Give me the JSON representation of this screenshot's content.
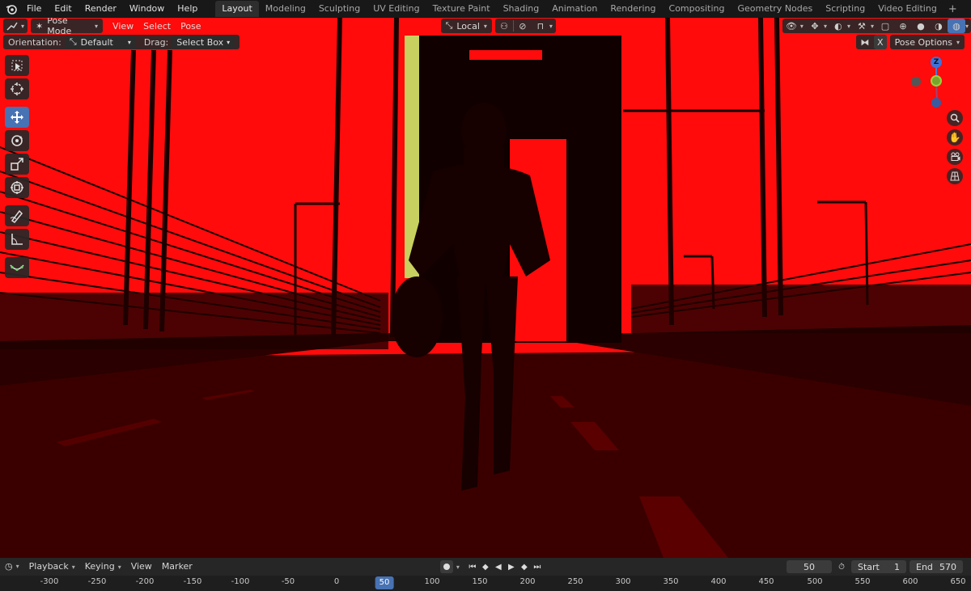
{
  "topbar": {
    "menus": [
      "File",
      "Edit",
      "Render",
      "Window",
      "Help"
    ],
    "workspaces": [
      "Layout",
      "Modeling",
      "Sculpting",
      "UV Editing",
      "Texture Paint",
      "Shading",
      "Animation",
      "Rendering",
      "Compositing",
      "Geometry Nodes",
      "Scripting",
      "Video Editing"
    ],
    "active_workspace": "Layout",
    "add_workspace": "+"
  },
  "viewport_header": {
    "mode": "Pose Mode",
    "menus": [
      "View",
      "Select",
      "Pose"
    ],
    "transform_orientation": "Local",
    "pose_options": "Pose Options",
    "x_mirror": "X"
  },
  "tool_settings": {
    "orientation_label": "Orientation:",
    "orientation_value": "Default",
    "drag_label": "Drag:",
    "drag_value": "Select Box"
  },
  "toolbar": {
    "tools": [
      "select-box-icon",
      "cursor-icon",
      "move-icon",
      "rotate-icon",
      "scale-icon",
      "transform-icon",
      "annotate-icon",
      "measure-icon",
      "relax-pose-icon"
    ],
    "active": "move-icon"
  },
  "gizmo": {
    "z_label": "Z"
  },
  "timeline": {
    "menus": [
      "Playback",
      "Keying",
      "View",
      "Marker"
    ],
    "current_frame": "50",
    "start_label": "Start",
    "start_value": "1",
    "end_label": "End",
    "end_value": "570"
  },
  "ruler": {
    "ticks": [
      "-300",
      "-250",
      "-200",
      "-150",
      "-100",
      "-50",
      "0",
      "50",
      "100",
      "150",
      "200",
      "250",
      "300",
      "350",
      "400",
      "450",
      "500",
      "550",
      "600",
      "650"
    ],
    "current": "50"
  },
  "colors": {
    "accent": "#4772b3",
    "scene_sky": "#ff0b0b",
    "scene_road": "#3a0000"
  }
}
